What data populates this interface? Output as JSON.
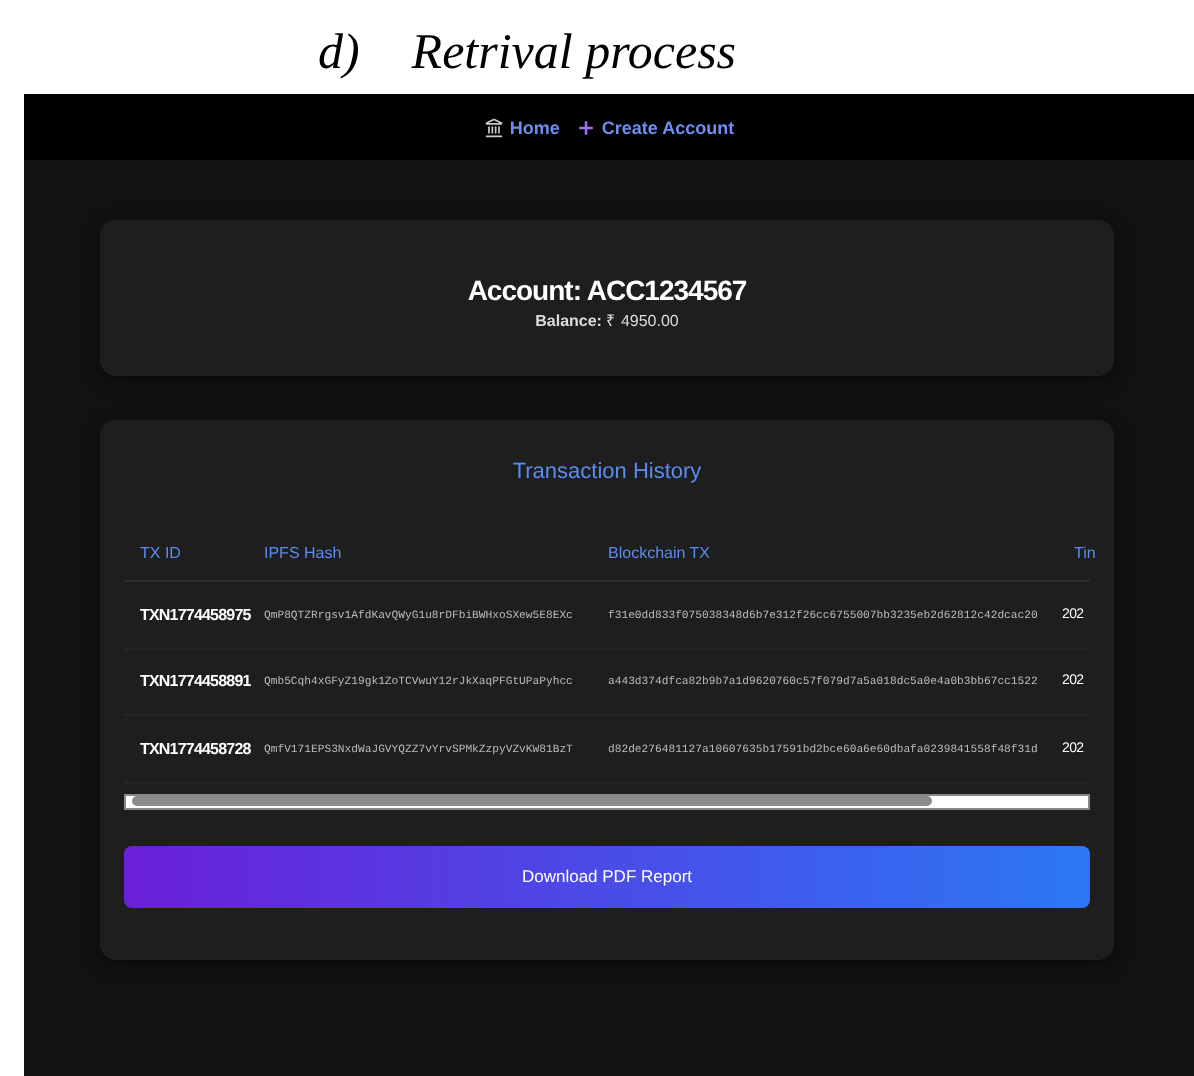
{
  "caption": {
    "label": "d)",
    "text": "Retrival process"
  },
  "nav": [
    {
      "label": "Home"
    },
    {
      "label": "Create Account"
    }
  ],
  "account": {
    "title": "Account: ACC1234567",
    "balance_label": "Balance:",
    "balance": "₹ 4950.00"
  },
  "history": {
    "title": "Transaction History",
    "columns": [
      "TX ID",
      "IPFS Hash",
      "Blockchain TX",
      "Tin"
    ],
    "rows": [
      {
        "tx_id": "TXN1774458975",
        "ipfs": "QmP8QTZRrgsv1AfdKavQWyG1u8rDFbiBWHxoSXew5E8EXc",
        "blockchain": "f31e0dd833f075038348d6b7e312f26cc6755007bb3235eb2d62812c42dcac20",
        "time": "202"
      },
      {
        "tx_id": "TXN1774458891",
        "ipfs": "Qmb5Cqh4xGFyZ19gk1ZoTCVwuY12rJkXaqPFGtUPaPyhcc",
        "blockchain": "a443d374dfca82b9b7a1d9620760c57f079d7a5a018dc5a0e4a0b3bb67cc1522",
        "time": "202"
      },
      {
        "tx_id": "TXN1774458728",
        "ipfs": "QmfV171EPS3NxdWaJGVYQZZ7vYrvSPMkZzpyVZvKW81BzT",
        "blockchain": "d82de276481127a10607635b17591bd2bce60a6e60dbafa0239841558f48f31d",
        "time": "202"
      }
    ],
    "button": "Download PDF Report"
  }
}
